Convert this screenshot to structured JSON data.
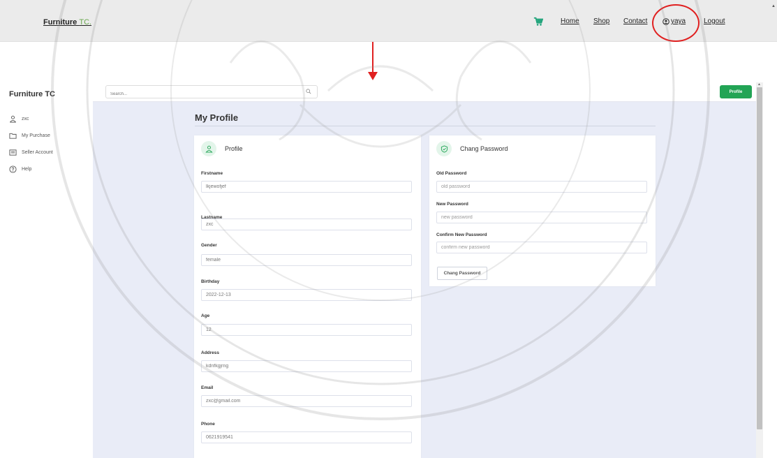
{
  "topnav": {
    "brand_main": "Furniture ",
    "brand_accent": "TC.",
    "links": {
      "home": "Home",
      "shop": "Shop",
      "contact": "Contact",
      "user": "yaya",
      "logout": "Logout"
    }
  },
  "sidebar": {
    "title": "Furniture TC",
    "items": [
      {
        "label": "zxc",
        "icon": "user-icon"
      },
      {
        "label": "My Purchase",
        "icon": "folder-icon"
      },
      {
        "label": "Seller Account",
        "icon": "store-card-icon"
      },
      {
        "label": "Help",
        "icon": "help-circle-icon"
      }
    ]
  },
  "header": {
    "search_placeholder": "Search...",
    "profile_button": "Profile"
  },
  "page": {
    "title": "My Profile"
  },
  "profile_card": {
    "title": "Profile",
    "fields": {
      "firstname": {
        "label": "Firstname",
        "value": "lkjewofjef"
      },
      "lastname": {
        "label": "Lastname",
        "value": "zxc"
      },
      "gender": {
        "label": "Gender",
        "value": "female"
      },
      "birthday": {
        "label": "Birthday",
        "value": "2022-12-13"
      },
      "age": {
        "label": "Age",
        "value": "12"
      },
      "address": {
        "label": "Address",
        "value": "kdnfkgjrng"
      },
      "email": {
        "label": "Email",
        "value": "zxc@gmail.com"
      },
      "phone": {
        "label": "Phone",
        "value": "0621919541"
      }
    }
  },
  "password_card": {
    "title": "Chang Password",
    "old": {
      "label": "Old Password",
      "placeholder": "old password"
    },
    "new": {
      "label": "New Password",
      "placeholder": "new password"
    },
    "confirm": {
      "label": "Confirm New Password",
      "placeholder": "confirm new password"
    },
    "button": "Chang Password"
  },
  "colors": {
    "accent_green": "#22a455",
    "annotation_red": "#e02020",
    "content_bg": "#e9ecf7"
  }
}
